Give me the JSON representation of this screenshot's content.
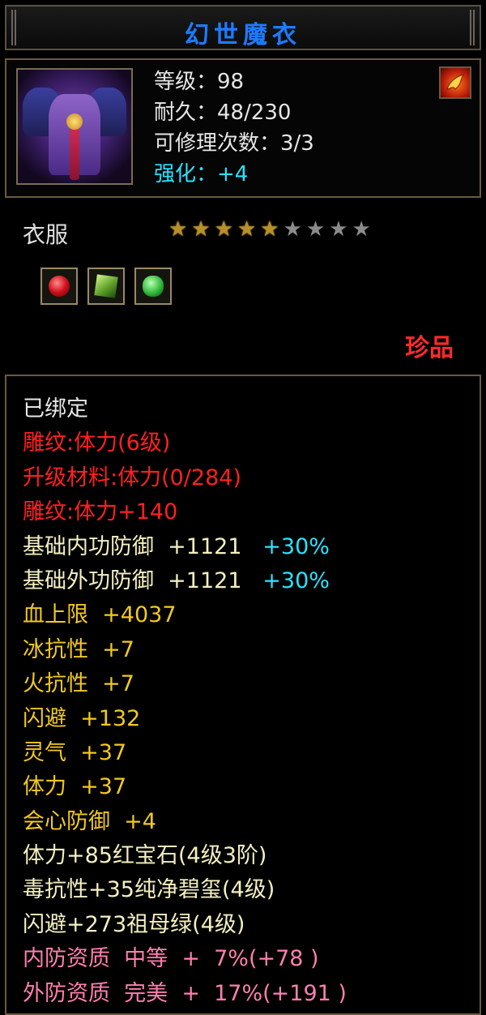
{
  "title": "幻世魔衣",
  "header": {
    "item_icon": "purple-armor-icon",
    "level": "等级：98",
    "durability": "耐久：48/230",
    "repair_count": "可修理次数：3/3",
    "enhance": "强化：+4",
    "tool_icon": "fire-dragon-icon"
  },
  "category": "衣服",
  "stars": {
    "filled": 5,
    "total": 9
  },
  "gems": [
    "ruby-gem-icon",
    "jade-seal-icon",
    "emerald-gem-icon"
  ],
  "rarity": "珍品",
  "attributes": {
    "bound": "已绑定",
    "carve1": "雕纹:体力(6级)",
    "upgrade_material": "升级材料:体力(0/284)",
    "carve2": "雕纹:体力+140",
    "inner_def": "基础内功防御  +1121",
    "inner_def_pct": "+30%",
    "outer_def": "基础外功防御  +1121",
    "outer_def_pct": "+30%",
    "hp": "血上限  +4037",
    "ice_res": "冰抗性  +7",
    "fire_res": "火抗性  +7",
    "dodge": "闪避  +132",
    "spirit": "灵气  +37",
    "stamina": "体力  +37",
    "crit_def": "会心防御  +4",
    "gem1": "体力+85红宝石(4级3阶)",
    "gem2": "毒抗性+35纯净碧玺(4级)",
    "gem3": "闪避+273祖母绿(4级)",
    "inner_quality": "内防资质  中等  +  7%(+78 )",
    "outer_quality": "外防资质  完美  +  17%(+191 )"
  }
}
